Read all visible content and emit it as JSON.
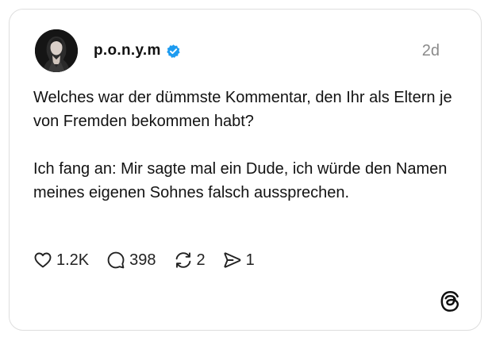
{
  "post": {
    "username": "p.o.n.y.m",
    "verified": true,
    "timestamp": "2d",
    "paragraphs": [
      "Welches war der dümmste Kommentar, den Ihr als Eltern je von Fremden bekommen habt?",
      "Ich fang an: Mir sagte mal ein Dude, ich würde den Namen meines eigenen Sohnes falsch aussprechen."
    ]
  },
  "actions": {
    "likes": "1.2K",
    "replies": "398",
    "reposts": "2",
    "shares": "1"
  },
  "colors": {
    "verified_badge": "#1d9bf0",
    "border": "#dedede",
    "muted_text": "#8a8a8a"
  },
  "icons": [
    "heart-icon",
    "comment-icon",
    "repost-icon",
    "share-icon",
    "verified-badge-icon",
    "threads-logo-icon"
  ]
}
